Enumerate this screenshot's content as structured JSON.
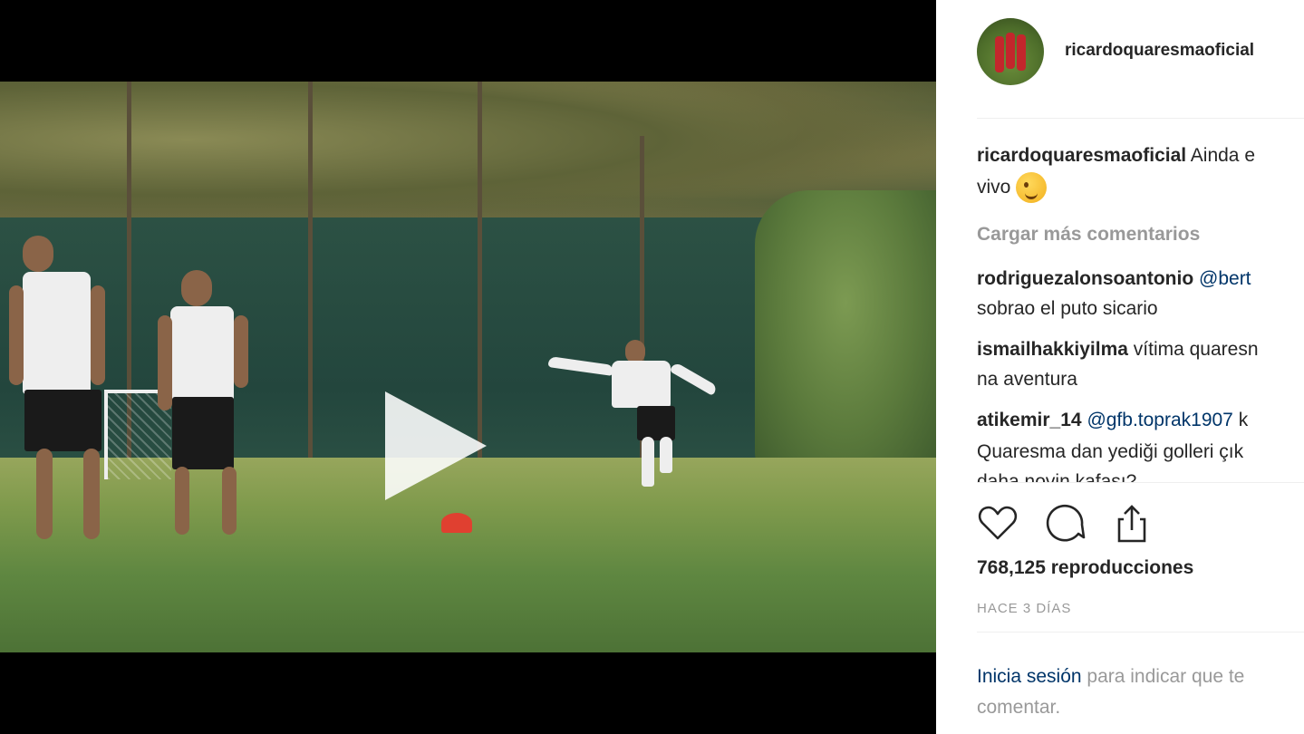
{
  "post": {
    "username": "ricardoquaresmaoficial",
    "caption_user": "ricardoquaresmaoficial",
    "caption_text_line1": "Ainda e",
    "caption_text_line2": "vivo",
    "load_more": "Cargar más comentarios",
    "comments": [
      {
        "user": "rodriguezalonsoantonio",
        "mention": "@bert",
        "line2": "sobrao el puto sicario"
      },
      {
        "user": "ismailhakkiyilma",
        "text": "vítima quaresn",
        "line2": "na aventura"
      },
      {
        "user": "atikemir_14",
        "mention": "@gfb.toprak1907",
        "text": "k",
        "line2": "Quaresma dan yediği golleri çık",
        "line3": "daha novin kafası?"
      }
    ],
    "views": "768,125 reproducciones",
    "time": "HACE 3 DÍAS",
    "login_link": "Inicia sesión",
    "login_text1": "para indicar que te",
    "login_text2": "comentar."
  },
  "icons": {
    "play": "play-icon",
    "like": "heart-icon",
    "comment": "comment-icon",
    "share": "share-icon"
  },
  "colors": {
    "link": "#003569",
    "muted": "#999999",
    "text": "#262626"
  }
}
